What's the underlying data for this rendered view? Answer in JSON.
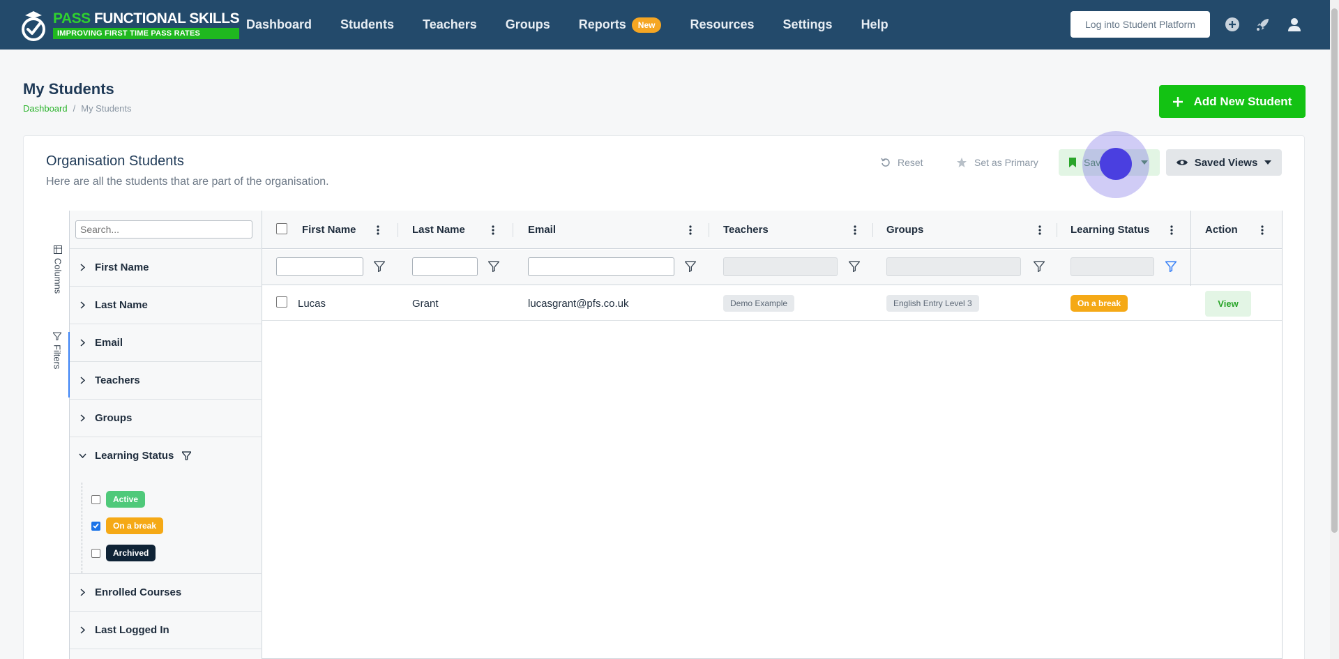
{
  "brand": {
    "line1_a": "PASS",
    "line1_b": "FUNCTIONAL SKILLS",
    "line2": "IMPROVING FIRST TIME PASS RATES"
  },
  "nav": {
    "items": [
      {
        "label": "Dashboard"
      },
      {
        "label": "Students"
      },
      {
        "label": "Teachers"
      },
      {
        "label": "Groups"
      },
      {
        "label": "Reports",
        "badge": "New"
      },
      {
        "label": "Resources"
      },
      {
        "label": "Settings"
      },
      {
        "label": "Help"
      }
    ],
    "login_label": "Log into Student Platform"
  },
  "page": {
    "title": "My Students",
    "breadcrumb": [
      "Dashboard",
      "/",
      "My Students"
    ],
    "add_button": "Add New Student"
  },
  "card": {
    "title": "Organisation Students",
    "subtitle": "Here are all the students that are part of the organisation.",
    "reset_label": "Reset",
    "primary_label": "Set as Primary",
    "save_view_label": "Save View",
    "saved_views_label": "Saved Views"
  },
  "side_tabs": {
    "columns": "Columns",
    "filters": "Filters"
  },
  "panel": {
    "search_placeholder": "Search...",
    "rows": [
      "First Name",
      "Last Name",
      "Email",
      "Teachers",
      "Groups",
      "Learning Status",
      "Enrolled Courses",
      "Last Logged In"
    ],
    "status_options": [
      {
        "label": "Active",
        "checked": false
      },
      {
        "label": "On a break",
        "checked": true
      },
      {
        "label": "Archived",
        "checked": false
      }
    ]
  },
  "table": {
    "headers": [
      "First Name",
      "Last Name",
      "Email",
      "Teachers",
      "Groups",
      "Learning Status",
      "Action"
    ],
    "rows": [
      {
        "first_name": "Lucas",
        "last_name": "Grant",
        "email": "lucasgrant@pfs.co.uk",
        "teacher": "Demo Example",
        "group": "English Entry Level 3",
        "status": "On a break",
        "action": "View"
      }
    ]
  },
  "colors": {
    "nav_bg": "#234a6b",
    "brand_green": "#13c213",
    "status_break": "#f5a916",
    "status_active": "#4fc97a",
    "status_archived": "#0f2336"
  }
}
